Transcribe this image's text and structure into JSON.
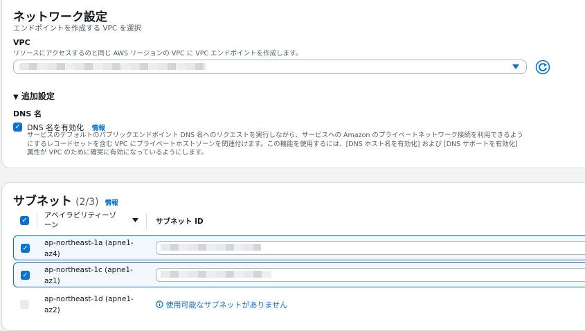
{
  "network": {
    "title": "ネットワーク設定",
    "subtitle": "エンドポイントを作成する VPC を選択",
    "vpc_label": "VPC",
    "vpc_desc": "リソースにアクセスするのと同じ AWS リージョンの VPC に VPC エンドポイントを作成します。",
    "additional_settings": "追加設定",
    "dns_label": "DNS 名",
    "dns_checkbox_label": "DNS 名を有効化",
    "info": "情報",
    "dns_desc_1": "サービスのデフォルトのパブリックエンドポイント DNS 名へのリクエストを実行しながら、サービスへの Amazon のプライベートネットワーク接続を利用できるよう",
    "dns_desc_2": "にするレコードセットを含む VPC にプライベートホストゾーンを関連付けます。この機能を使用するには、[DNS ホスト名を有効化] および [DNS サポートを有効化]",
    "dns_desc_3": "属性が VPC のために確実に有効になっているようにします。"
  },
  "subnet": {
    "title": "サブネット",
    "count": "(2/3)",
    "info": "情報",
    "col_az": "アベイラビリティーゾーン",
    "col_subnet": "サブネット ID",
    "rows": [
      {
        "az_1": "ap-northeast-1a (apne1-",
        "az_2": "az4)",
        "checked": true
      },
      {
        "az_1": "ap-northeast-1c (apne1-",
        "az_2": "az1)",
        "checked": true
      },
      {
        "az_1": "ap-northeast-1d (apne1-",
        "az_2": "az2)",
        "checked": false,
        "note": "使用可能なサブネットがありません"
      }
    ]
  },
  "colors": {
    "accent": "#0972d3"
  },
  "icons": {
    "refresh": "refresh-icon",
    "caret": "caret-down-icon",
    "info": "info-circle-icon"
  }
}
